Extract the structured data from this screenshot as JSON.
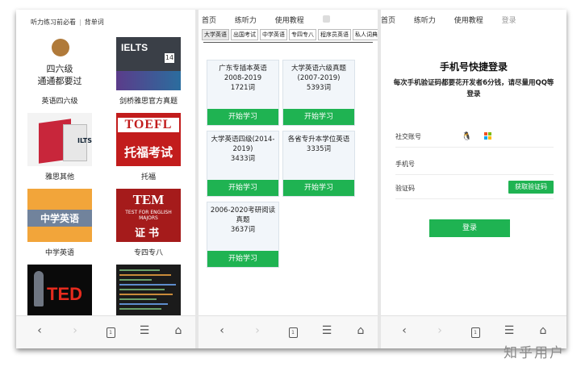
{
  "panel1": {
    "topbar": [
      "听力练习前必看",
      "背单词"
    ],
    "items": [
      {
        "label": "英语四六级",
        "thumb_text": [
          "四六级",
          "通通都要过"
        ]
      },
      {
        "label": "剑桥雅思官方真题",
        "thumb_text": [
          "IELTS",
          "14"
        ]
      },
      {
        "label": "雅思其他",
        "thumb_text": [
          "ILTS"
        ]
      },
      {
        "label": "托福",
        "thumb_text": [
          "TOEFL",
          "托福考试"
        ]
      },
      {
        "label": "中学英语",
        "thumb_text": [
          "中学英语"
        ]
      },
      {
        "label": "专四专八",
        "thumb_text": [
          "TEM",
          "TEST FOR ENGLISH MAJORS",
          "证书"
        ]
      },
      {
        "label": "",
        "thumb_text": [
          "TED"
        ]
      },
      {
        "label": "",
        "thumb_text": []
      }
    ]
  },
  "panel2": {
    "nav": [
      "首页",
      "练听力",
      "使用教程"
    ],
    "tabs": [
      "大学英语",
      "出国考试",
      "中学英语",
      "专四专八",
      "程序员英语",
      "私人词典"
    ],
    "active_tab": 0,
    "books": [
      {
        "title": "广东专插本英语2008-2019",
        "count": "1721词",
        "button": "开始学习"
      },
      {
        "title": "大学英语六级真题(2007-2019)",
        "count": "5393词",
        "button": "开始学习"
      },
      {
        "title": "大学英语四级(2014-2019)",
        "count": "3433词",
        "button": "开始学习"
      },
      {
        "title": "各省专升本学位英语",
        "count": "3335词",
        "button": "开始学习"
      },
      {
        "title": "2006-2020考研阅读真题",
        "count": "3637词",
        "button": "开始学习"
      }
    ]
  },
  "panel3": {
    "nav": [
      "首页",
      "练听力",
      "使用教程",
      "登录"
    ],
    "title": "手机号快捷登录",
    "message": "每次手机验证码都要花开发者6分钱，请尽量用QQ等登录",
    "social_label": "社交账号",
    "phone_label": "手机号",
    "code_label": "验证码",
    "code_button": "获取验证码",
    "login_button": "登录"
  },
  "nav_icons": [
    "back-icon",
    "forward-icon",
    "tabs-icon",
    "menu-icon",
    "home-icon"
  ],
  "tab_count": "1",
  "watermark": "知乎用户",
  "colors": {
    "accent": "#1fb352",
    "qq": "#3fa0e8"
  }
}
